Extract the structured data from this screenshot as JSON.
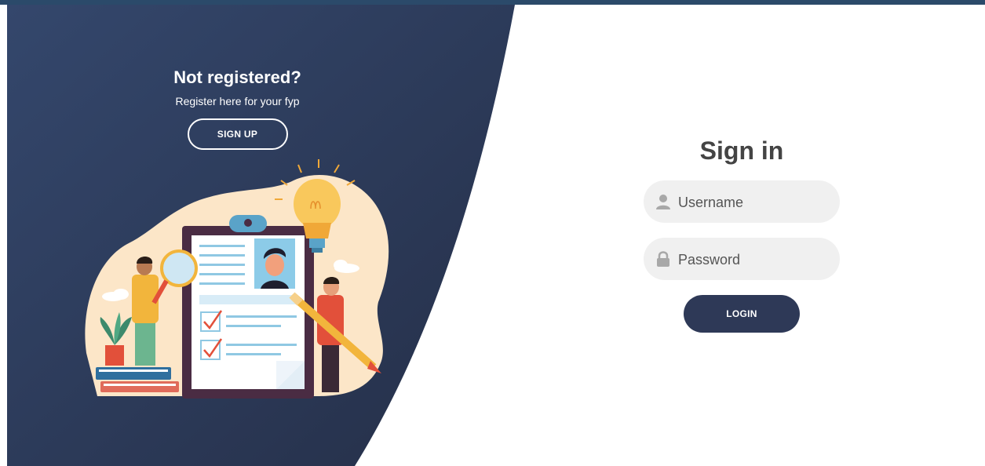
{
  "left_panel": {
    "title": "Not registered?",
    "subtitle": "Register here for your fyp",
    "signup_label": "SIGN UP",
    "background_color": "#2f3b58",
    "illustration_icon": "job-application-illustration"
  },
  "form": {
    "title": "Sign in",
    "username": {
      "placeholder": "Username",
      "value": "",
      "icon": "user-icon"
    },
    "password": {
      "placeholder": "Password",
      "value": "",
      "icon": "lock-icon"
    },
    "login_label": "LOGIN",
    "button_color": "#2e3957",
    "field_color": "#f0f0f0"
  }
}
